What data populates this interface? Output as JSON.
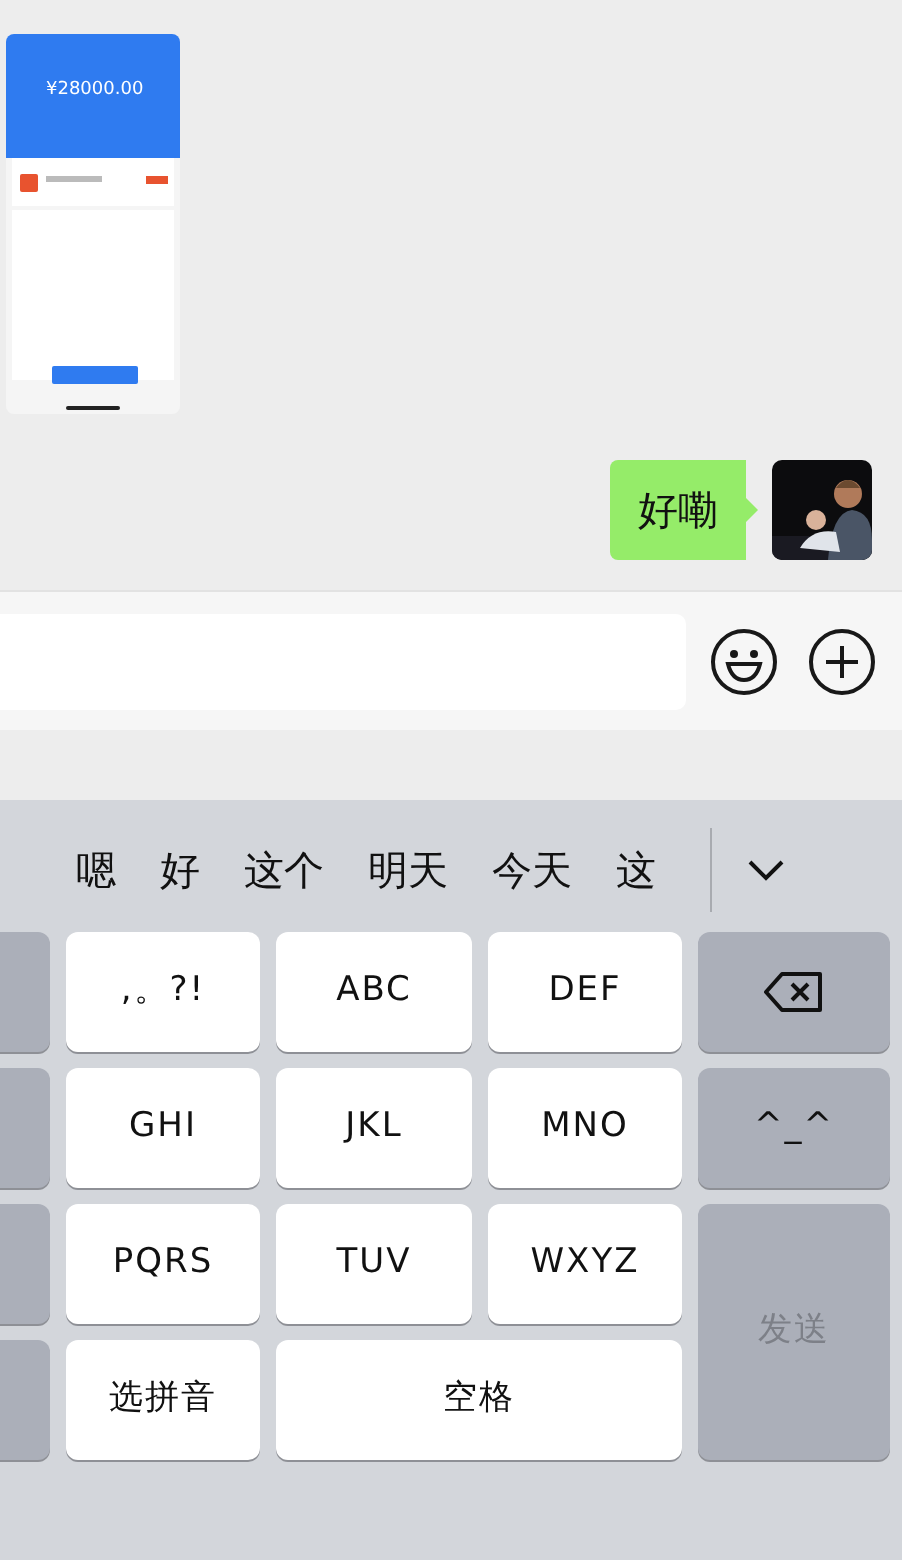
{
  "messages": [
    {
      "amount": "¥28000.00"
    },
    {
      "kind": "text",
      "text": "好嘞"
    }
  ],
  "candidates": [
    "嗯",
    "好",
    "这个",
    "明天",
    "今天",
    "这"
  ],
  "keys": [
    {
      "kind": "side"
    },
    {
      "kind": "key",
      "label": ",。?!"
    },
    {
      "kind": "key",
      "label": "ABC"
    },
    {
      "kind": "key",
      "label": "DEF"
    },
    {
      "kind": "delete"
    },
    {
      "kind": "side"
    },
    {
      "kind": "key",
      "label": "GHI"
    },
    {
      "kind": "key",
      "label": "JKL"
    },
    {
      "kind": "key",
      "label": "MNO"
    },
    {
      "kind": "func",
      "label": "^_^"
    },
    {
      "kind": "side"
    },
    {
      "kind": "key",
      "label": "PQRS"
    },
    {
      "kind": "key",
      "label": "TUV"
    },
    {
      "kind": "key",
      "label": "WXYZ"
    },
    {
      "kind": "send",
      "label": "发送",
      "disabled": true
    },
    {
      "kind": "side"
    },
    {
      "kind": "key",
      "label": "选拼音"
    },
    {
      "kind": "space",
      "label": "空格"
    }
  ]
}
